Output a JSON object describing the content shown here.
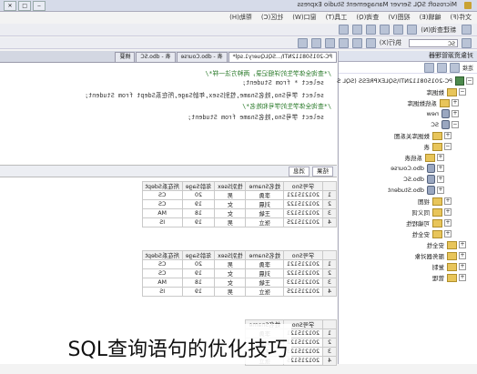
{
  "window": {
    "title": "Microsoft SQL Server Management Studio Express"
  },
  "menu": [
    "文件(F)",
    "编辑(E)",
    "视图(V)",
    "查询(Q)",
    "工具(T)",
    "窗口(W)",
    "社区(C)",
    "帮助(H)"
  ],
  "toolbar": {
    "new_query_label": "新建查询(N)",
    "database": "SC",
    "execute_label": "执行(X)"
  },
  "explorer": {
    "title": "对象资源管理器",
    "connect_label": "连接",
    "server": "PC-201508112NTI\\SQLEXPRESS (SQL Ser",
    "items": [
      "数据库",
      "系统数据库",
      "new",
      "SC",
      "数据库关系图",
      "表",
      "系统表",
      "dbo.Course",
      "dbo.SC",
      "dbo.Student",
      "视图",
      "同义词",
      "可编程性",
      "安全性",
      "安全性",
      "服务器对象",
      "复制",
      "管理"
    ]
  },
  "editor": {
    "tabs": [
      "PC-201508112NTI\\...SQLQuery1.sql*",
      "表 - dbo.Course",
      "表 - dbo.SC",
      "摘要"
    ],
    "lines": [
      {
        "kind": "comment",
        "text": "/*查询全体学生的详细记录，两种方法一样*/"
      },
      {
        "kind": "code",
        "text": "select * from Student;"
      },
      {
        "kind": "code",
        "text": "select 学号Sno,姓名Sname,性别Ssex,年龄Sage,所在系Sdept from Student;"
      },
      {
        "kind": "comment",
        "text": "/*查询全体学生的学号和姓名*/"
      },
      {
        "kind": "code",
        "text": "select 学号Sno,姓名Sname from Student;"
      }
    ]
  },
  "results": {
    "tabs": [
      "结果",
      "消息"
    ],
    "grid1": {
      "headers": [
        "学号Sno",
        "姓名Sname",
        "性别Ssex",
        "年龄Sage",
        "所在系Sdept"
      ],
      "rows": [
        [
          "1",
          "201215121",
          "李勇",
          "男",
          "20",
          "CS"
        ],
        [
          "2",
          "201215122",
          "刘晨",
          "女",
          "19",
          "CS"
        ],
        [
          "3",
          "201215123",
          "王敏",
          "女",
          "18",
          "MA"
        ],
        [
          "4",
          "201215125",
          "张立",
          "男",
          "19",
          "IS"
        ]
      ]
    },
    "grid2": {
      "headers": [
        "学号Sno",
        "姓名Sname",
        "性别Ssex",
        "年龄Sage",
        "所在系Sdept"
      ],
      "rows": [
        [
          "1",
          "201215121",
          "李勇",
          "男",
          "20",
          "CS"
        ],
        [
          "2",
          "201215122",
          "刘晨",
          "女",
          "19",
          "CS"
        ],
        [
          "3",
          "201215123",
          "王敏",
          "女",
          "18",
          "MA"
        ],
        [
          "4",
          "201215125",
          "张立",
          "男",
          "19",
          "IS"
        ]
      ]
    },
    "grid3": {
      "headers": [
        "学号Sno",
        "姓名Sname"
      ],
      "rows": [
        [
          "1",
          "201215121",
          "李勇"
        ],
        [
          "2",
          "201215122",
          "刘晨"
        ],
        [
          "3",
          "201215123",
          "王敏"
        ],
        [
          "4",
          "201215125",
          "张立"
        ]
      ]
    }
  },
  "caption": "SQL查询语句的优化技巧"
}
